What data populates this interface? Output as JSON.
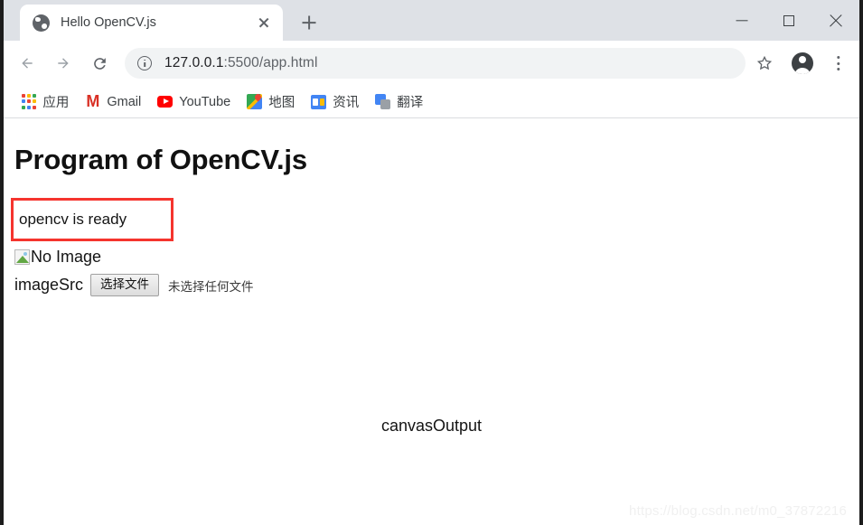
{
  "window": {
    "controls": {
      "minimize": "minimize-button",
      "maximize": "maximize-button",
      "close": "close-button"
    }
  },
  "tabs": [
    {
      "title": "Hello OpenCV.js",
      "favicon": "globe-icon",
      "active": true,
      "close_label": "×"
    }
  ],
  "newtab": {
    "label": "+"
  },
  "toolbar": {
    "back": "back-arrow-icon",
    "forward": "forward-arrow-icon",
    "reload": "reload-icon",
    "security_icon": "info-circle-icon",
    "url_host": "127.0.0.1",
    "url_path": ":5500/app.html",
    "url_full": "127.0.0.1:5500/app.html",
    "bookmark_star": "star-icon",
    "profile": "avatar-icon",
    "menu": "kebab-menu-icon"
  },
  "bookmarks": [
    {
      "label": "应用",
      "icon": "apps-grid-icon"
    },
    {
      "label": "Gmail",
      "icon": "gmail-icon"
    },
    {
      "label": "YouTube",
      "icon": "youtube-icon"
    },
    {
      "label": "地图",
      "icon": "maps-icon"
    },
    {
      "label": "资讯",
      "icon": "news-icon"
    },
    {
      "label": "翻译",
      "icon": "translate-icon"
    }
  ],
  "page": {
    "heading": "Program of OpenCV.js",
    "status": "opencv is ready",
    "status_border_color": "#f5342e",
    "image_alt": "No Image",
    "file_input": {
      "label": "imageSrc",
      "button": "选择文件",
      "status": "未选择任何文件"
    },
    "canvas_output": "canvasOutput",
    "watermark": "https://blog.csdn.net/m0_37872216"
  }
}
